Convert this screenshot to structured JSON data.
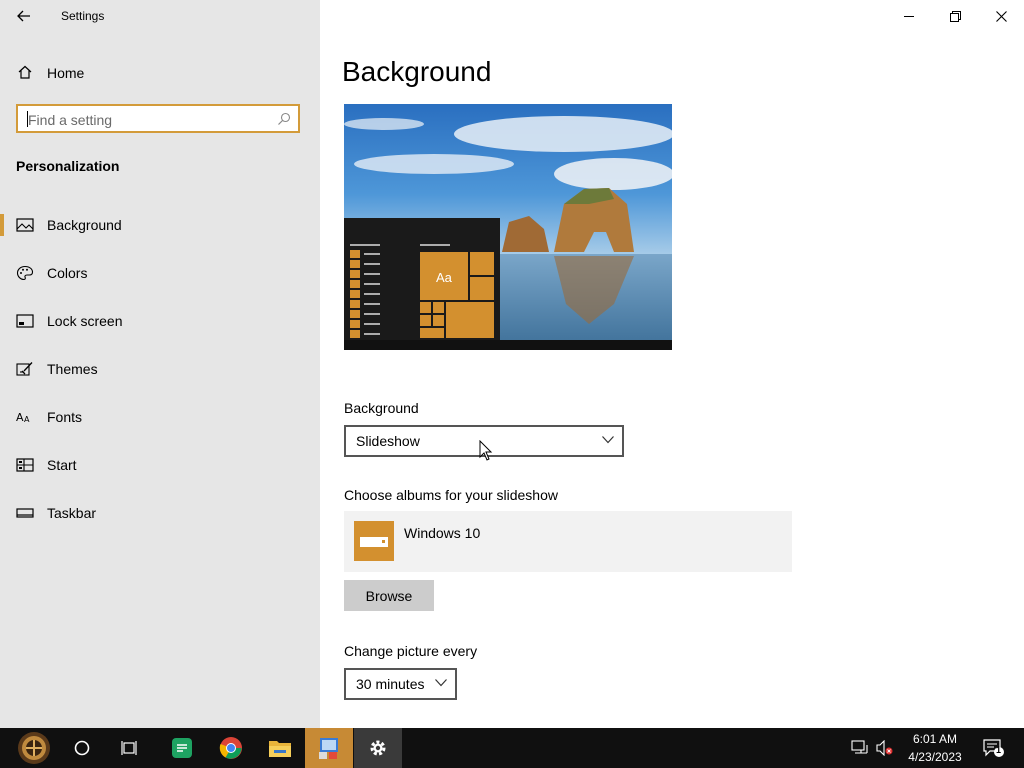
{
  "window": {
    "title": "Settings",
    "controls": [
      "minimize",
      "restore",
      "close"
    ]
  },
  "sidebar": {
    "home_label": "Home",
    "search_placeholder": "Find a setting",
    "section_heading": "Personalization",
    "items": [
      {
        "label": "Background",
        "icon": "picture-icon",
        "selected": true
      },
      {
        "label": "Colors",
        "icon": "palette-icon",
        "selected": false
      },
      {
        "label": "Lock screen",
        "icon": "lock-screen-icon",
        "selected": false
      },
      {
        "label": "Themes",
        "icon": "themes-brush-icon",
        "selected": false
      },
      {
        "label": "Fonts",
        "icon": "fonts-icon",
        "selected": false
      },
      {
        "label": "Start",
        "icon": "start-icon",
        "selected": false
      },
      {
        "label": "Taskbar",
        "icon": "taskbar-icon",
        "selected": false
      }
    ]
  },
  "main": {
    "title": "Background",
    "preview": {
      "tile_text": "Aa"
    },
    "background_label": "Background",
    "background_value": "Slideshow",
    "albums_label": "Choose albums for your slideshow",
    "album_name": "Windows 10",
    "browse_label": "Browse",
    "interval_label": "Change picture every",
    "interval_value": "30 minutes"
  },
  "taskbar": {
    "apps": [
      "start-icon",
      "cortana-icon",
      "task-view-icon",
      "sheets-icon",
      "chrome-icon",
      "file-explorer-icon",
      "control-panel-icon",
      "settings-icon"
    ],
    "time": "6:01 AM",
    "date": "4/23/2023",
    "notification_count": "1"
  },
  "colors": {
    "accent": "#d39b3a",
    "sidebar_bg": "#e6e6e6",
    "taskbar_bg": "#101010"
  }
}
